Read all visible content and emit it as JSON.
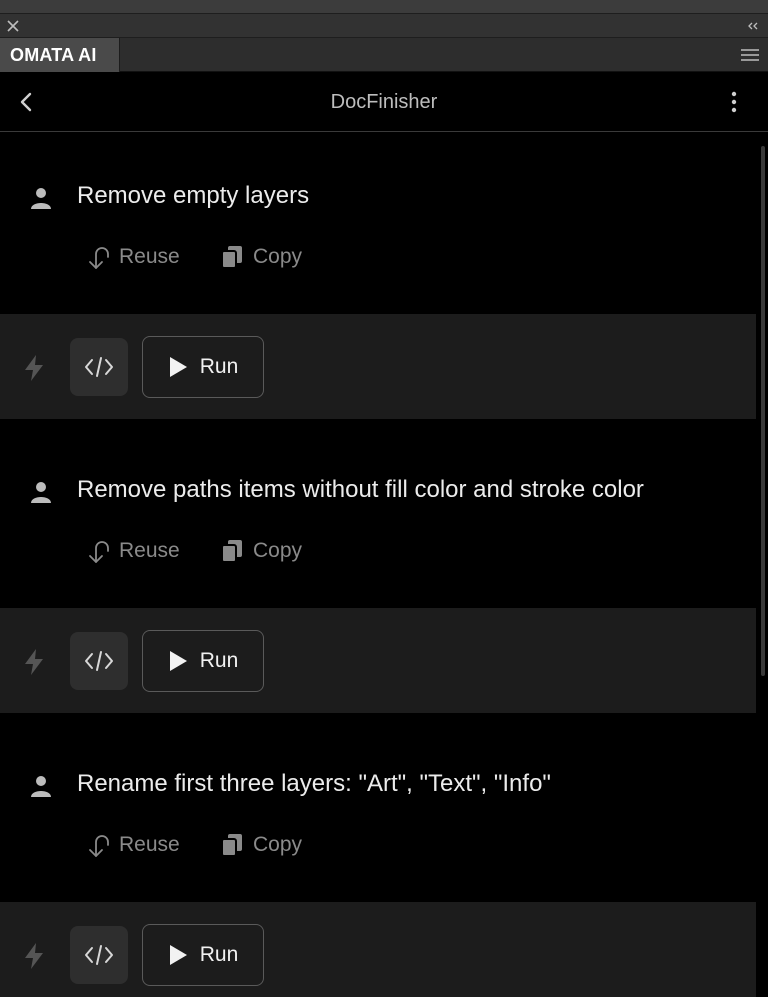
{
  "panel": {
    "tab_label": "OMATA AI",
    "close_icon": "close-icon",
    "collapse_icon": "double-chevron-left-icon",
    "menu_icon": "hamburger-menu-icon"
  },
  "header": {
    "title": "DocFinisher",
    "back_icon": "chevron-left-icon",
    "more_icon": "kebab-menu-icon"
  },
  "actions": {
    "reuse_label": "Reuse",
    "copy_label": "Copy",
    "run_label": "Run"
  },
  "messages": [
    {
      "prompt": "Remove empty layers"
    },
    {
      "prompt": "Remove paths items without fill color and stroke color"
    },
    {
      "prompt": "Rename first three layers: \"Art\", \"Text\", \"Info\""
    }
  ],
  "colors": {
    "background": "#000000",
    "run_bar": "#1c1c1c",
    "muted_text": "#8a8a8a",
    "primary_text": "#ececec"
  }
}
